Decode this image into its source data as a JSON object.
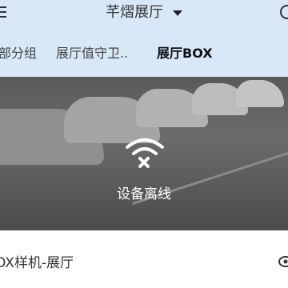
{
  "header": {
    "title": "芊熠展厅",
    "tabs": [
      {
        "label": "部分组",
        "active": false
      },
      {
        "label": "展厅值守卫..",
        "active": false
      },
      {
        "label": "展厅BOX",
        "active": true
      }
    ]
  },
  "video": {
    "status_text": "设备离线",
    "status_icon": "wifi-offline-icon"
  },
  "device": {
    "name": "OX样机-展厅"
  },
  "colors": {
    "header_bg": "#d9e8f7",
    "text": "#333333"
  }
}
